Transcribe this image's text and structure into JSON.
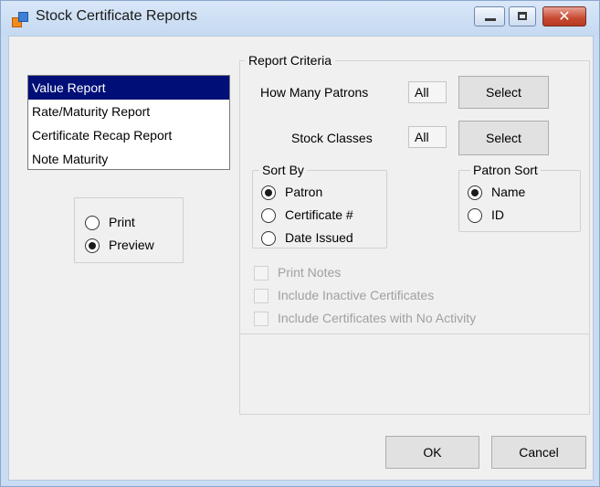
{
  "window": {
    "title": "Stock Certificate Reports",
    "close_glyph": "✕"
  },
  "report_list": {
    "items": [
      "Value Report",
      "Rate/Maturity Report",
      "Certificate Recap Report",
      "Note Maturity"
    ],
    "selected_index": 0
  },
  "output": {
    "options": [
      "Print",
      "Preview"
    ],
    "selected": "Preview"
  },
  "criteria": {
    "title": "Report Criteria",
    "patrons_label": "How Many Patrons",
    "patrons_value": "All",
    "classes_label": "Stock Classes",
    "classes_value": "All",
    "select_label": "Select"
  },
  "sort_by": {
    "title": "Sort By",
    "options": [
      "Patron",
      "Certificate #",
      "Date Issued"
    ],
    "selected": "Patron"
  },
  "patron_sort": {
    "title": "Patron Sort",
    "options": [
      "Name",
      "ID"
    ],
    "selected": "Name"
  },
  "checkboxes": [
    {
      "label": "Print Notes",
      "checked": false,
      "enabled": false
    },
    {
      "label": "Include Inactive Certificates",
      "checked": false,
      "enabled": false
    },
    {
      "label": "Include Certificates with No Activity",
      "checked": false,
      "enabled": false
    }
  ],
  "buttons": {
    "ok": "OK",
    "cancel": "Cancel"
  },
  "colors": {
    "selection": "#000f78",
    "title_bar": "#c5d9f1",
    "close_button": "#c74a31"
  }
}
